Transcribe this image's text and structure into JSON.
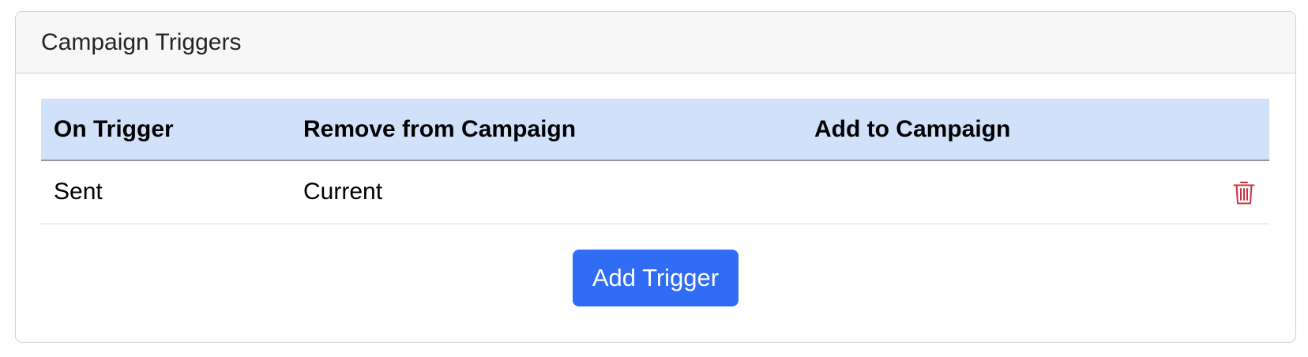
{
  "card": {
    "title": "Campaign Triggers"
  },
  "table": {
    "headers": {
      "on_trigger": "On Trigger",
      "remove_from_campaign": "Remove from Campaign",
      "add_to_campaign": "Add to Campaign"
    },
    "rows": [
      {
        "on_trigger": "Sent",
        "remove_from_campaign": "Current",
        "add_to_campaign": "",
        "action_icon": "trash-icon"
      }
    ]
  },
  "actions": {
    "add_trigger_label": "Add Trigger"
  },
  "colors": {
    "accent": "#316cf4",
    "header_bg": "#d1e1fa",
    "delete": "#c9303e"
  }
}
